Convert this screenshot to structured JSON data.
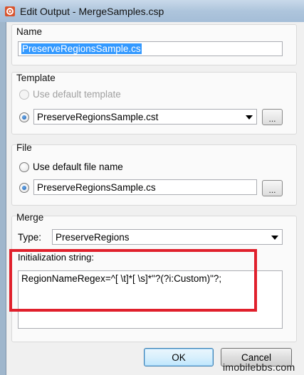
{
  "window": {
    "title": "Edit Output - MergeSamples.csp",
    "icon": "gear-app-icon"
  },
  "name_group": {
    "label": "Name",
    "value": "PreserveRegionsSample.cs"
  },
  "template_group": {
    "label": "Template",
    "use_default_label": "Use default template",
    "selected_template": "PreserveRegionsSample.cst",
    "browse_label": "..."
  },
  "file_group": {
    "label": "File",
    "use_default_label": "Use default file name",
    "file_name": "PreserveRegionsSample.cs",
    "browse_label": "..."
  },
  "merge_group": {
    "label": "Merge",
    "type_label": "Type:",
    "type_value": "PreserveRegions",
    "init_label": "Initialization string:",
    "init_value": "RegionNameRegex=^[ \\t]*[ \\s]*\"?(?i:Custom)\"?;"
  },
  "buttons": {
    "ok": "OK",
    "cancel": "Cancel"
  },
  "watermark": "imobilebbs.com",
  "colors": {
    "highlight": "#e0202c",
    "selection": "#3399ff"
  }
}
